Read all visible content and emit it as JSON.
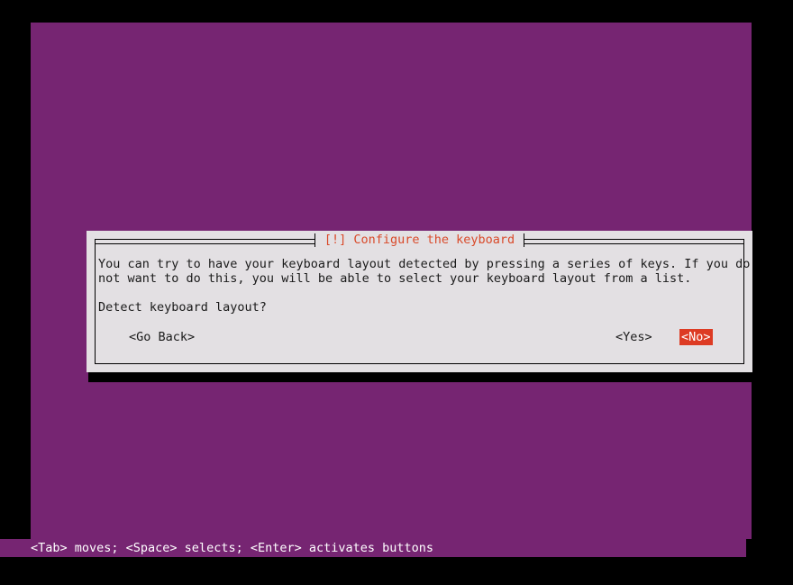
{
  "screen": {
    "background_color": "#000000",
    "console_background_color": "#762572"
  },
  "dialog": {
    "title": "[!] Configure the keyboard",
    "title_color": "#d94a2a",
    "background_color": "#e3e0e3",
    "body_paragraph": "You can try to have your keyboard layout detected by pressing a series of keys. If you do\nnot want to do this, you will be able to select your keyboard layout from a list.",
    "question": "Detect keyboard layout?",
    "buttons": [
      {
        "label": "<Go Back>",
        "selected": false
      },
      {
        "label": "<Yes>",
        "selected": false
      },
      {
        "label": "<No>",
        "selected": true,
        "highlight_color": "#dd3b24",
        "text_color": "#ffffff"
      }
    ]
  },
  "status_bar": {
    "text": "<Tab> moves; <Space> selects; <Enter> activates buttons",
    "background_color": "#762572",
    "text_color": "#ffffff"
  }
}
